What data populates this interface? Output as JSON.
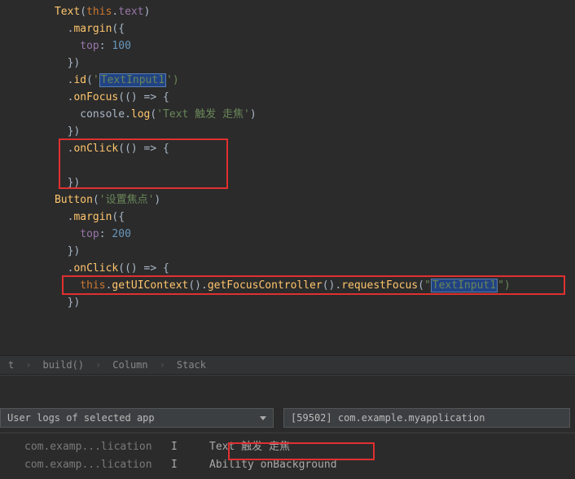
{
  "code": {
    "l1a": "Text",
    "l1b": "this",
    "l1c": "text",
    "l2a": "margin",
    "l3a": "top",
    "l3b": "100",
    "l4a": "})",
    "l5a": "id",
    "l5b": "'",
    "l5c": "TextInput1",
    "l5d": "')",
    "l6a": "onFocus",
    "l6b": "(() => {",
    "l7a": "console",
    "l7b": "log",
    "l7c": "'Text 触发 走焦'",
    "l8a": "})",
    "l9a": "onClick",
    "l9b": "(() => {",
    "l10": "",
    "l11a": "})",
    "l12a": "Button",
    "l12b": "'设置焦点'",
    "l13a": "margin",
    "l14a": "top",
    "l14b": "200",
    "l15a": "})",
    "l16a": "onClick",
    "l16b": "(() => {",
    "l17a": "this",
    "l17b": "getUIContext",
    "l17c": "getFocusController",
    "l17d": "requestFocus",
    "l17e": "\"",
    "l17f": "TextInput1",
    "l17g": "\")",
    "l18a": "})"
  },
  "breadcrumb": {
    "a": "t",
    "b": "build()",
    "c": "Column",
    "d": "Stack"
  },
  "logControls": {
    "filterLabel": "User logs of selected app",
    "appLabel": "[59502] com.example.myapplication"
  },
  "logs": {
    "r1pkg": "com.examp...lication",
    "r1lvl": "I",
    "r1msg": "Text 触发 走焦",
    "r2pkg": "com.examp...lication",
    "r2lvl": "I",
    "r2msg": "Ability onBackground"
  }
}
